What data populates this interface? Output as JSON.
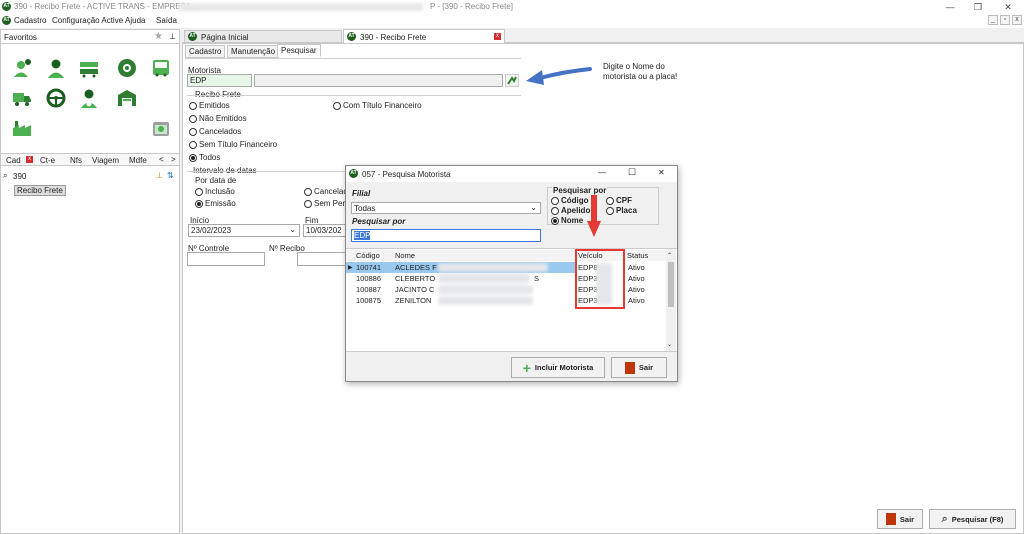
{
  "window": {
    "title_left": "390 - Recibo Frete - ACTIVE TRANS - EMPRESA:",
    "title_right": "P - [390 - Recibo Frete]",
    "minimize": "—",
    "maximize": "❐",
    "close": "✕"
  },
  "menu": {
    "items": [
      "Cadastro",
      "Configuração Active",
      "Ajuda",
      "Saída"
    ]
  },
  "mdi": {
    "min": "_",
    "restore": "▫",
    "close": "x"
  },
  "sidebar": {
    "favorites_label": "Favoritos",
    "bottom_tabs": [
      "Cad",
      "Ct-e",
      "Nfs",
      "Viagem",
      "Mdfe"
    ],
    "search_value": "390",
    "tree_item": "Recibo Frete",
    "tree_dot": "·"
  },
  "doc_tabs": {
    "home": "Página Inicial",
    "active": "390 - Recibo Frete"
  },
  "sub_tabs": [
    "Cadastro",
    "Manutenção",
    "Pesquisar"
  ],
  "form": {
    "motorista_label": "Motorista",
    "motorista_code": "EDP",
    "motorista_name": "",
    "recibo_group": "Recibo Frete",
    "recibo_options": [
      "Emitidos",
      "Não Emitidos",
      "Cancelados",
      "Sem Título Financeiro",
      "Todos"
    ],
    "recibo_selected": "Todos",
    "com_titulo": "Com Título Financeiro",
    "intervalo_group": "Intervalo de datas",
    "por_data": "Por data de",
    "inclusao": "Inclusão",
    "emissao": "Emissão",
    "cancelad": "Cancelad",
    "sem_per": "Sem Per",
    "inicio_label": "Início",
    "inicio_value": "23/02/2023",
    "fim_label": "Fim",
    "fim_value": "10/03/202",
    "controle_label": "Nº Controle",
    "recibo_label": "Nº Recibo"
  },
  "annotation": {
    "text_line1": "Digite o Nome do",
    "text_line2": "motorista ou a placa!",
    "arrow_color": "#4472c4"
  },
  "dialog": {
    "title": "057 - Pesquisa Motorista",
    "filial_label": "Filial",
    "filial_value": "Todas",
    "pesquisar_por_label": "Pesquisar por",
    "pesquisar_value": "EDP",
    "pesquisar_por_group": "Pesquisar por",
    "options": [
      "Código",
      "Apelido",
      "Nome",
      "CPF",
      "Placa"
    ],
    "selected": "Nome",
    "columns": [
      "Código",
      "Nome",
      "Veículo",
      "Status"
    ],
    "rows": [
      {
        "codigo": "100741",
        "nome": "ACLEDES F",
        "veiculo": "EDP8",
        "status": "Ativo"
      },
      {
        "codigo": "100886",
        "nome": "CLEBERTO",
        "veiculo": "EDP3",
        "status": "Ativo"
      },
      {
        "codigo": "100887",
        "nome": "JACINTO C",
        "veiculo": "EDP3",
        "status": "Ativo"
      },
      {
        "codigo": "100875",
        "nome": "ZENILTON",
        "veiculo": "EDP3",
        "status": "Ativo"
      }
    ],
    "row_extra": "S",
    "btn_incluir": "Incluir Motorista",
    "btn_sair": "Sair",
    "highlight_color": "#e53935"
  },
  "bottom_buttons": {
    "sair": "Sair",
    "pesquisar": "Pesquisar (F8)"
  },
  "colors": {
    "accent_green": "#1b5e20",
    "selection_blue": "#99c9ef"
  }
}
